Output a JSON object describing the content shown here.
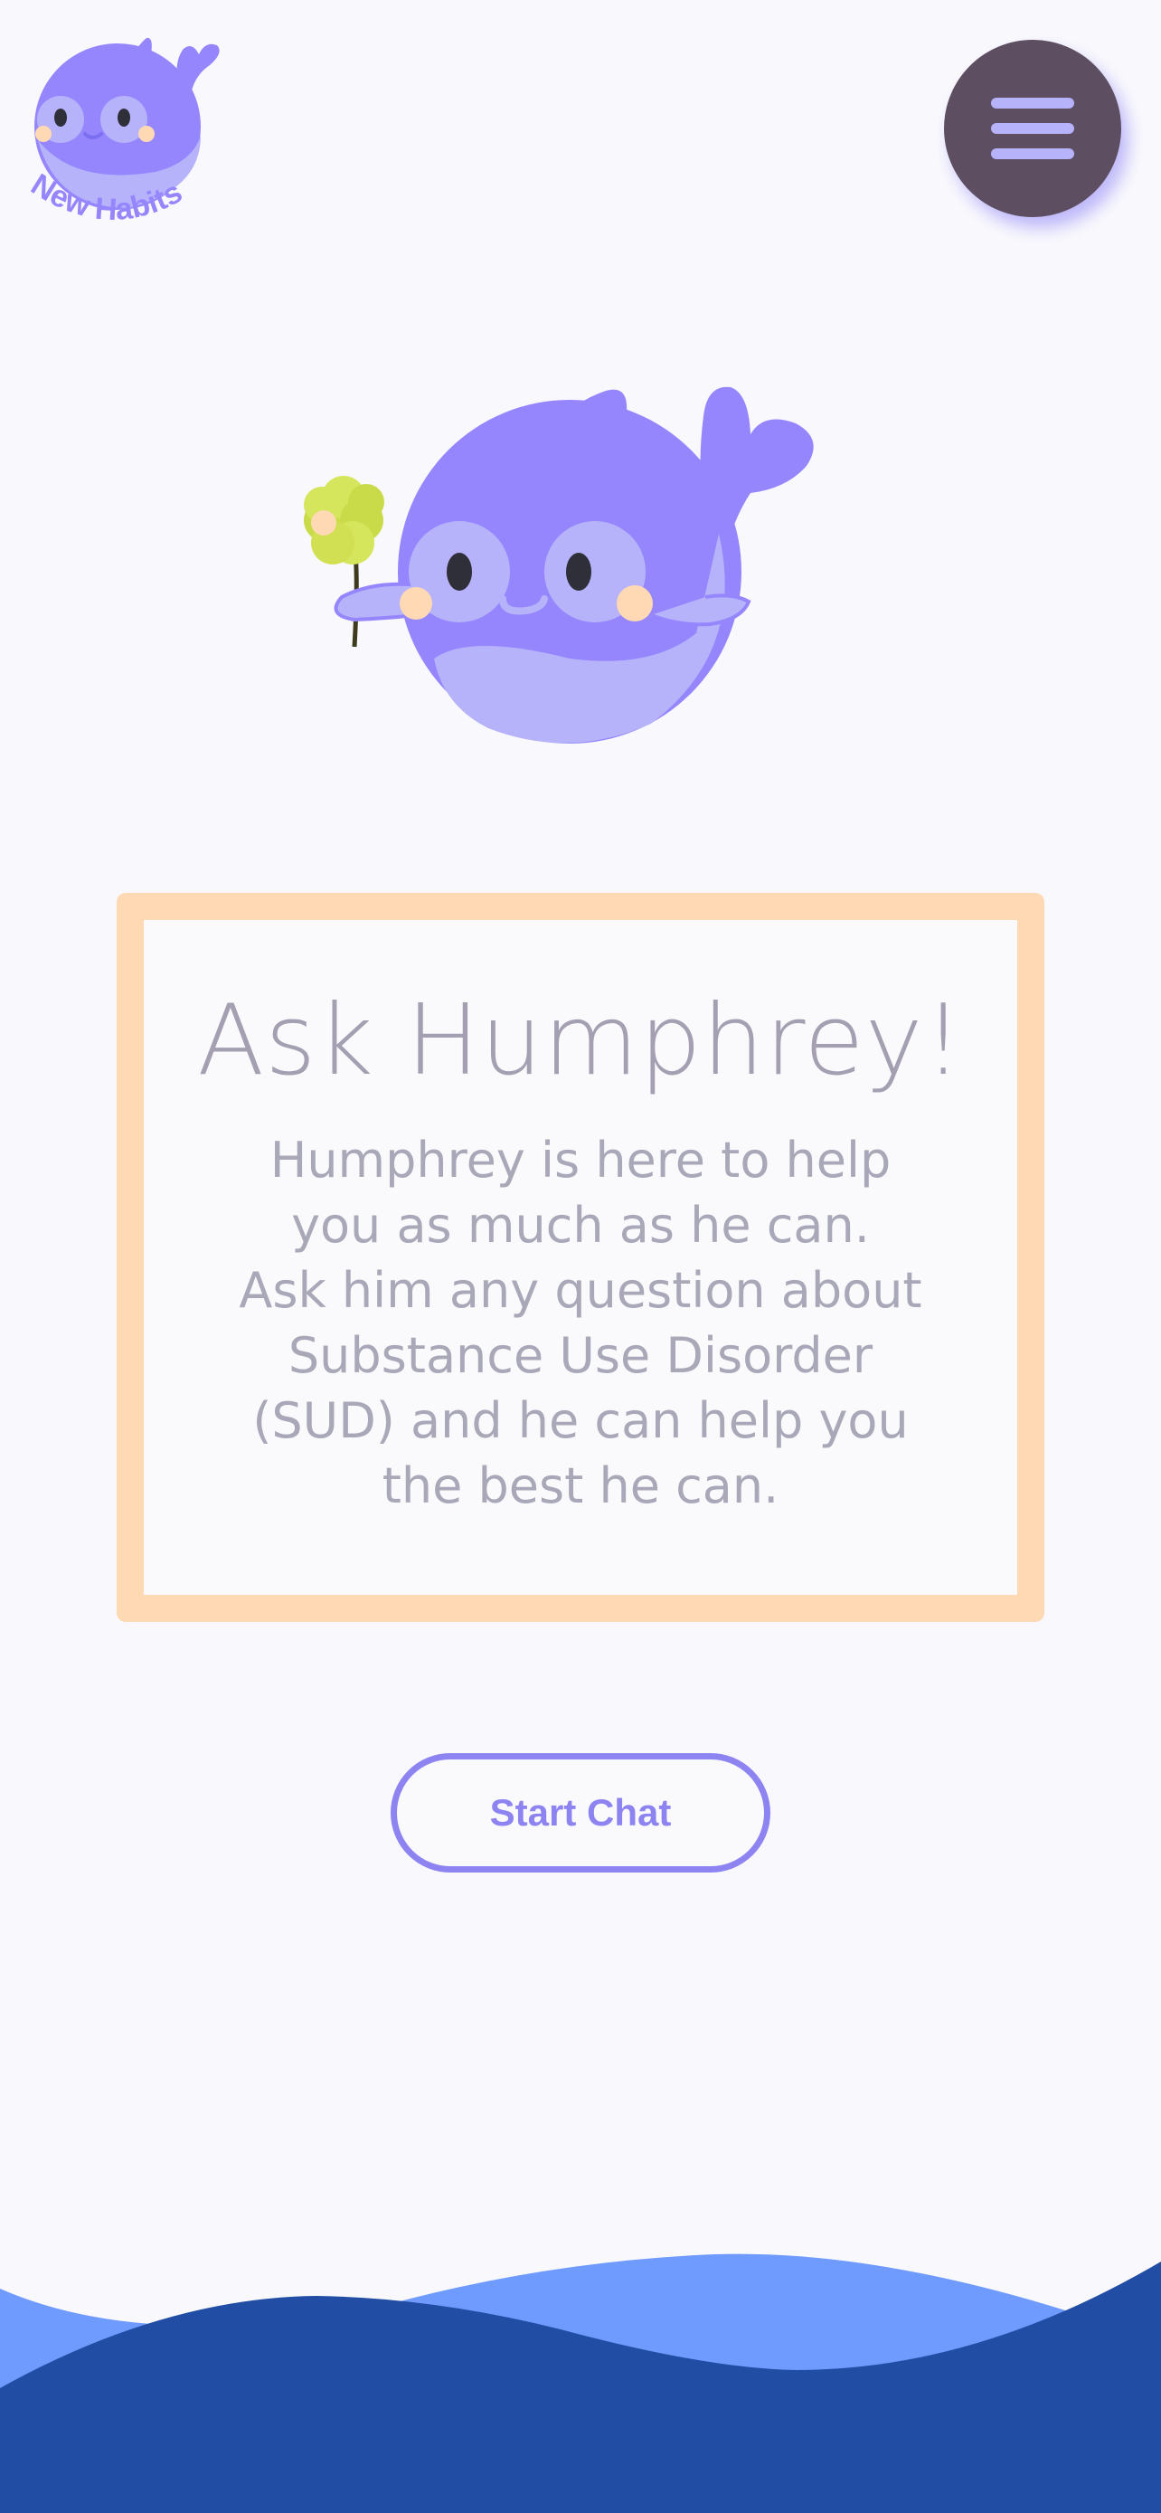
{
  "logo": {
    "brand_text": "New Habits",
    "icon": "whale-logo-icon"
  },
  "header": {
    "menu_icon": "hamburger-menu-icon"
  },
  "mascot": {
    "icon": "whale-holding-flower-icon"
  },
  "card": {
    "title": "Ask Humphrey!",
    "body": "Humphrey is here to help\nyou as much as he can.\nAsk him any question about\nSubstance Use Disorder\n(SUD) and he can help you\nthe best he can."
  },
  "actions": {
    "start_chat_label": "Start Chat"
  },
  "colors": {
    "background": "#f9f9fd",
    "whale_purple": "#9586fd",
    "whale_light": "#b6b3fa",
    "card_border": "#fed9b4",
    "accent": "#8d84f1",
    "menu_button": "#5d4f61",
    "wave_light": "#6e9bfd",
    "wave_dark": "#214ea4"
  }
}
